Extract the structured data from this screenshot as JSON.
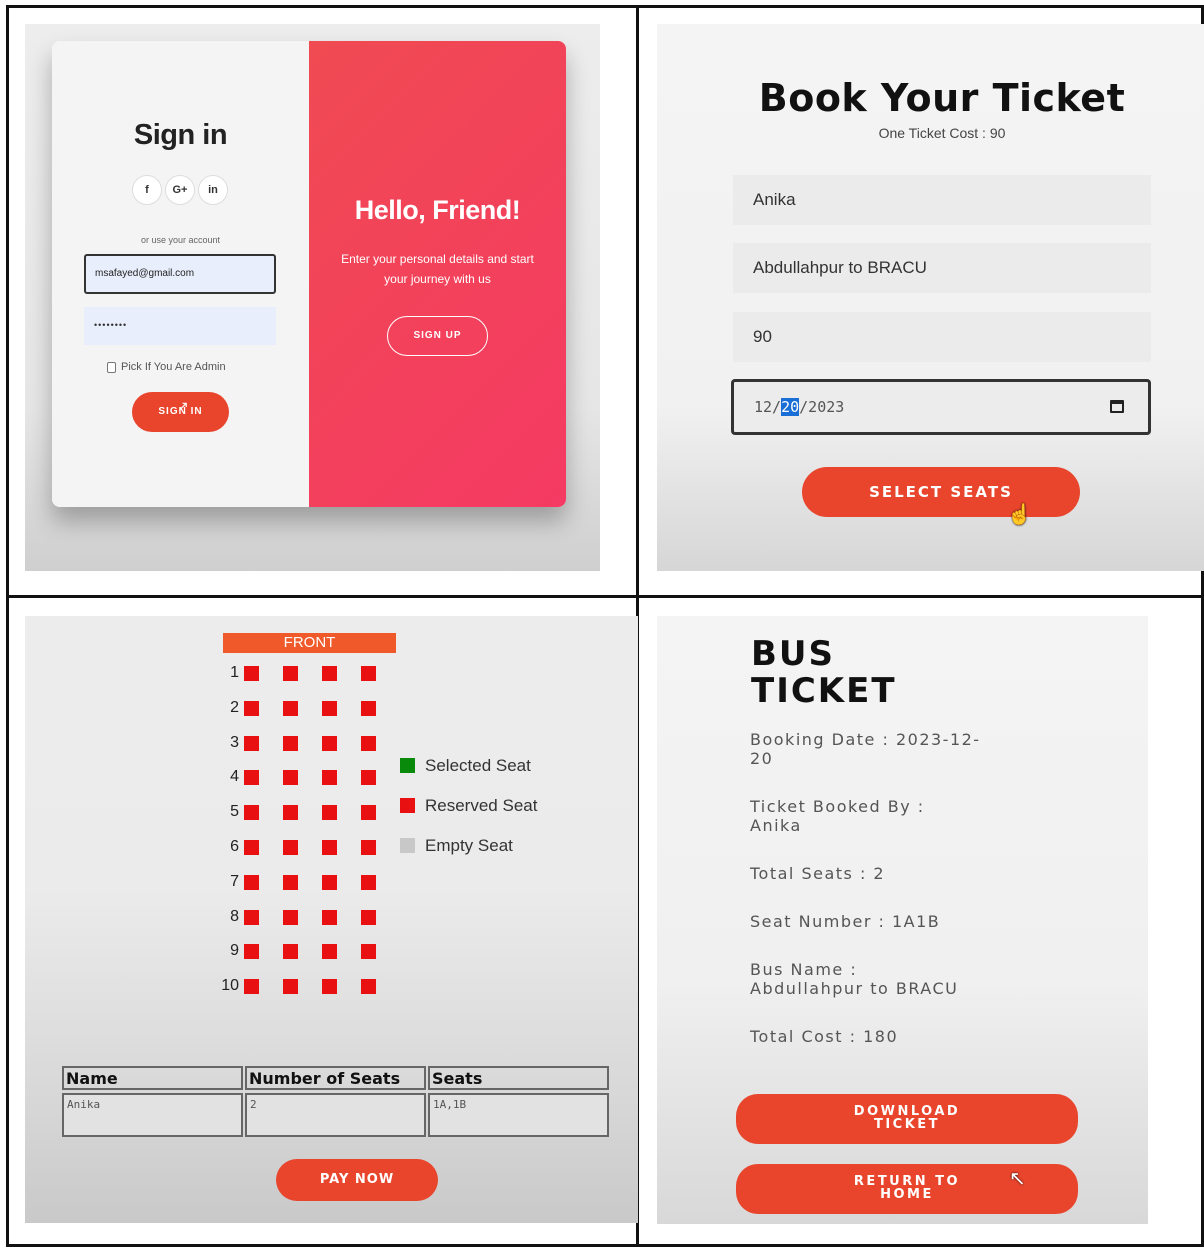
{
  "signin": {
    "title": "Sign in",
    "social": [
      "f",
      "G+",
      "in"
    ],
    "or_text": "or use your account",
    "email_value": "msafayed@gmail.com",
    "password_value": "••••••••",
    "admin_label": "Pick If You Are Admin",
    "signin_button": "SIGN IN",
    "hello_title": "Hello, Friend!",
    "hello_sub": "Enter your personal details and start your journey with us",
    "signup_button": "SIGN UP"
  },
  "booking": {
    "title": "Book Your Ticket",
    "subtitle": "One Ticket Cost : 90",
    "name_value": "Anika",
    "route_value": "Abdullahpur to BRACU",
    "cost_value": "90",
    "date_month": "12/",
    "date_day": "20",
    "date_year": "/2023",
    "select_button": "SELECT SEATS"
  },
  "seats": {
    "front_label": "FRONT",
    "rows": [
      "1",
      "2",
      "3",
      "4",
      "5",
      "6",
      "7",
      "8",
      "9",
      "10"
    ],
    "colors": {
      "selected": "#0a8a0a",
      "reserved": "#e81010",
      "empty": "#c8c8c8"
    },
    "legend": {
      "selected": "Selected Seat",
      "reserved": "Reserved Seat",
      "empty": "Empty Seat"
    },
    "table": {
      "headers": [
        "Name",
        "Number of Seats",
        "Seats"
      ],
      "values": [
        "Anika",
        "2",
        "1A,1B"
      ]
    },
    "pay_button": "PAY NOW"
  },
  "ticket": {
    "title_line1": "BUS",
    "title_line2": "TICKET",
    "booking_date_1": "Booking Date : 2023-12-",
    "booking_date_2": "20",
    "booked_by_1": "Ticket Booked By :",
    "booked_by_2": "Anika",
    "total_seats": "Total Seats : 2",
    "seat_number": "Seat Number : 1A1B",
    "bus_name_1": "Bus Name :",
    "bus_name_2": "Abdullahpur to BRACU",
    "total_cost": "Total Cost : 180",
    "download_1": "DOWNLOAD",
    "download_2": "TICKET",
    "return_1": "RETURN TO",
    "return_2": "HOME"
  }
}
